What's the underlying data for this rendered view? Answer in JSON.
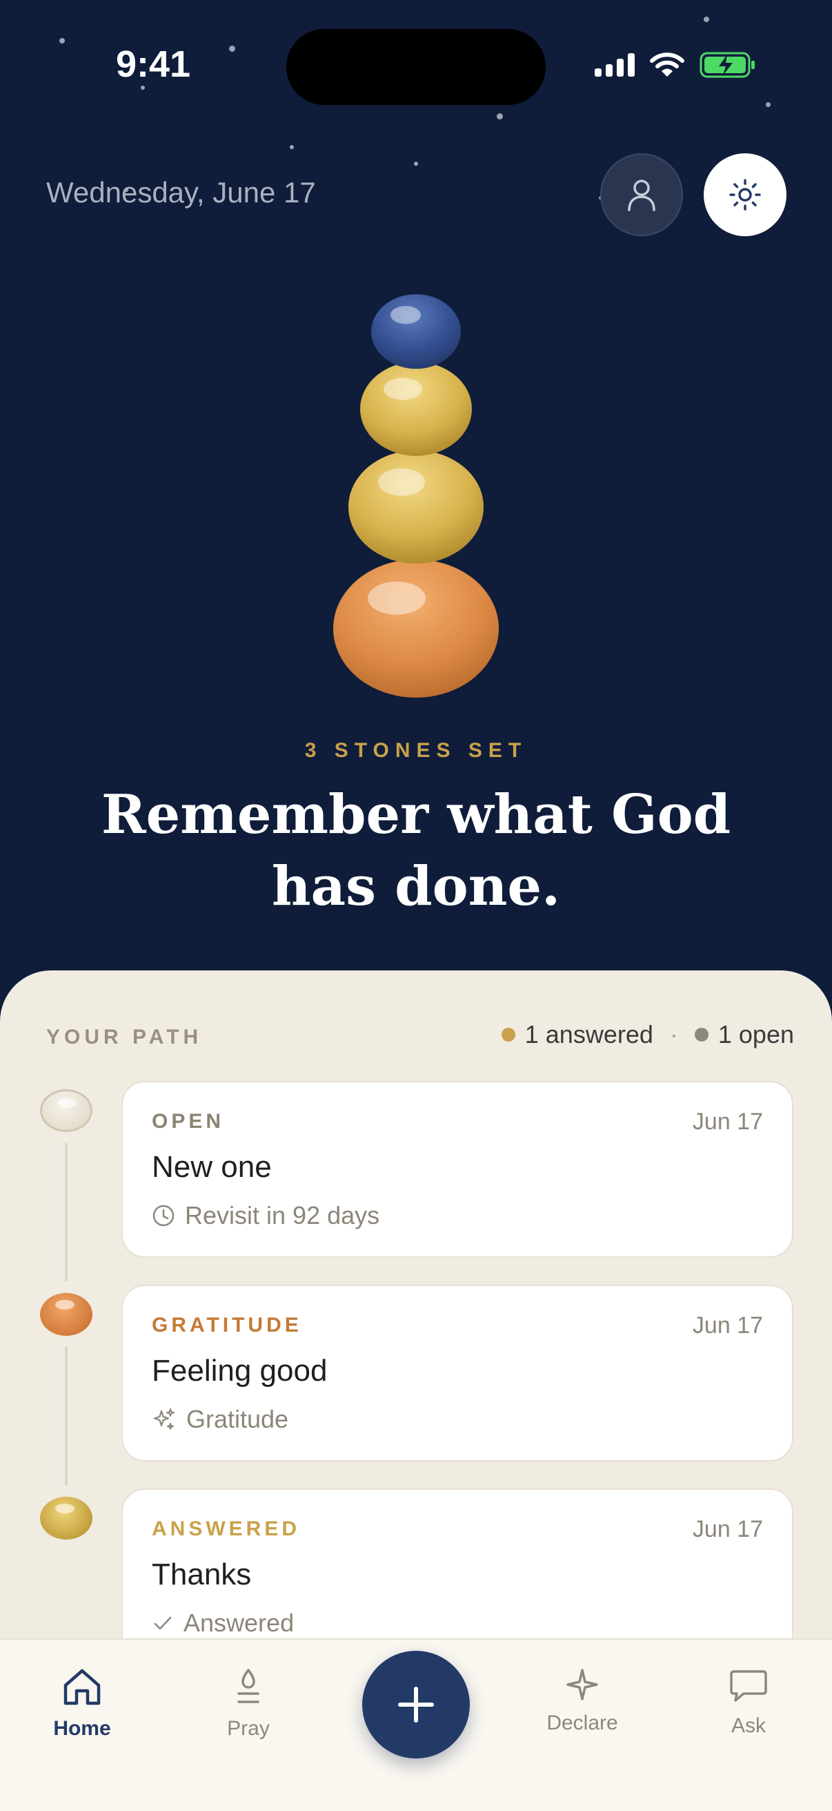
{
  "status_bar": {
    "time": "9:41"
  },
  "header": {
    "date": "Wednesday, June 17"
  },
  "hero": {
    "stones_count": "3 STONES SET",
    "headline_line1": "Remember what God",
    "headline_line2": "has done."
  },
  "path": {
    "label": "YOUR PATH",
    "answered": "1 answered",
    "open": "1 open",
    "separator": "·",
    "entries": [
      {
        "kind": "OPEN",
        "date": "Jun 17",
        "title": "New one",
        "meta": "Revisit in 92 days",
        "kind_color": "#8c8372",
        "stone_color": "#e8e2d3"
      },
      {
        "kind": "GRATITUDE",
        "date": "Jun 17",
        "title": "Feeling good",
        "meta": "Gratitude",
        "kind_color": "#c47a35",
        "stone_color": "#d57f3e"
      },
      {
        "kind": "ANSWERED",
        "date": "Jun 17",
        "title": "Thanks",
        "meta": "Answered",
        "kind_color": "#c9a14a",
        "stone_color": "#c9a230"
      }
    ]
  },
  "tabs": [
    {
      "label": "Home",
      "icon": "home-icon",
      "active": true
    },
    {
      "label": "Pray",
      "icon": "candle-icon"
    },
    {
      "label": "Declare",
      "icon": "sparkle-icon"
    },
    {
      "label": "Ask",
      "icon": "chat-bubble-icon"
    }
  ],
  "colors": {
    "navy": "#0f1d3a",
    "gold": "#c9a14a",
    "sheet": "#f1ece2",
    "accent": "#233a66"
  }
}
